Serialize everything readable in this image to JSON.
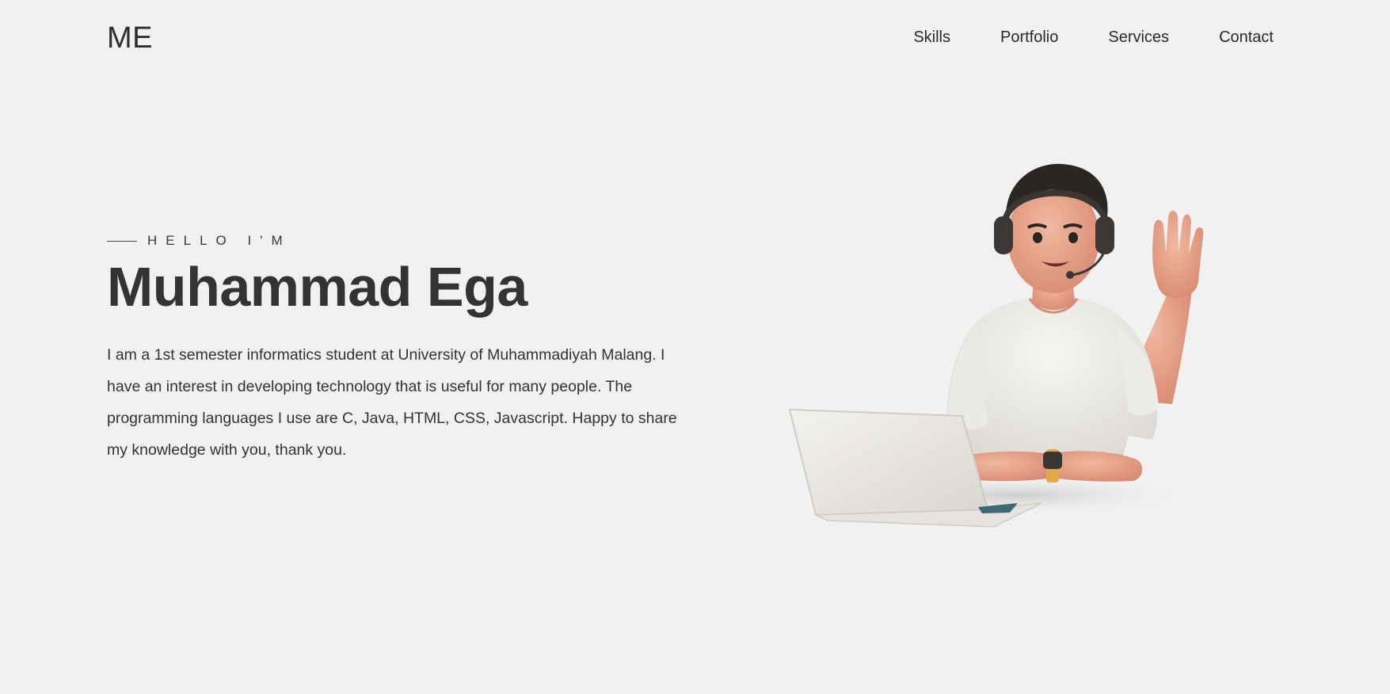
{
  "header": {
    "logo": "ME",
    "nav": [
      {
        "label": "Skills"
      },
      {
        "label": "Portfolio"
      },
      {
        "label": "Services"
      },
      {
        "label": "Contact"
      }
    ]
  },
  "hero": {
    "eyebrow": "HELLO I'M",
    "name": "Muhammad Ega",
    "bio": "I am a 1st semester informatics student at University of Muhammadiyah Malang. I have an interest in developing technology that is useful for many people. The programming languages I use are C, Java, HTML, CSS, Javascript. Happy to share my knowledge with you, thank you."
  },
  "colors": {
    "background": "#f1f1f1",
    "text": "#333333",
    "skin": "#e8a48c",
    "shirt": "#f2f0ec",
    "hair": "#2a2624",
    "watch": "#e0a94a"
  }
}
